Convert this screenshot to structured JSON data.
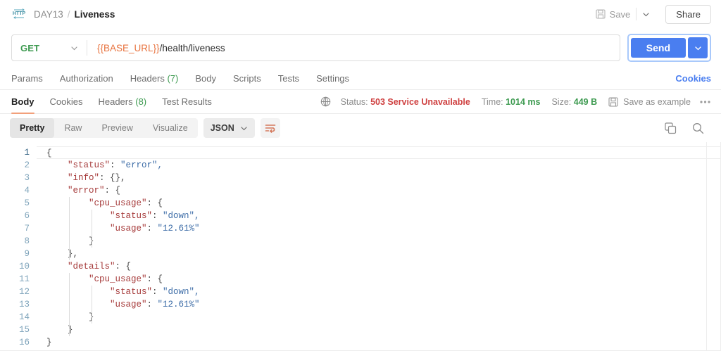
{
  "header": {
    "protocol_icon": "http-icon",
    "breadcrumb": {
      "folder": "DAY13",
      "separator": "/",
      "current": "Liveness"
    },
    "save_label": "Save",
    "share_label": "Share"
  },
  "request": {
    "method": "GET",
    "url_variable": "{{BASE_URL}}",
    "url_path": "/health/liveness",
    "send_label": "Send",
    "tabs": [
      {
        "label": "Params",
        "count": null,
        "active": false
      },
      {
        "label": "Authorization",
        "count": null,
        "active": false
      },
      {
        "label": "Headers",
        "count": "(7)",
        "active": false
      },
      {
        "label": "Body",
        "count": null,
        "active": false
      },
      {
        "label": "Scripts",
        "count": null,
        "active": false
      },
      {
        "label": "Tests",
        "count": null,
        "active": false
      },
      {
        "label": "Settings",
        "count": null,
        "active": false
      }
    ],
    "cookies_link": "Cookies"
  },
  "response": {
    "tabs": [
      {
        "label": "Body",
        "count": null,
        "active": true
      },
      {
        "label": "Cookies",
        "count": null,
        "active": false
      },
      {
        "label": "Headers",
        "count": "(8)",
        "active": false
      },
      {
        "label": "Test Results",
        "count": null,
        "active": false
      }
    ],
    "status": {
      "status_label": "Status:",
      "status_value": "503 Service Unavailable",
      "time_label": "Time:",
      "time_value": "1014 ms",
      "size_label": "Size:",
      "size_value": "449 B"
    },
    "save_as_example": "Save as example",
    "more_menu": "•••",
    "format_tabs": [
      {
        "label": "Pretty",
        "active": true
      },
      {
        "label": "Raw",
        "active": false
      },
      {
        "label": "Preview",
        "active": false
      },
      {
        "label": "Visualize",
        "active": false
      }
    ],
    "content_type": "JSON"
  },
  "code": {
    "lines": [
      {
        "n": "1",
        "indent": 0,
        "text": "{"
      },
      {
        "n": "2",
        "indent": 1,
        "text": "\"status\": \"error\","
      },
      {
        "n": "3",
        "indent": 1,
        "text": "\"info\": {},"
      },
      {
        "n": "4",
        "indent": 1,
        "text": "\"error\": {"
      },
      {
        "n": "5",
        "indent": 2,
        "text": "\"cpu_usage\": {"
      },
      {
        "n": "6",
        "indent": 3,
        "text": "\"status\": \"down\","
      },
      {
        "n": "7",
        "indent": 3,
        "text": "\"usage\": \"12.61%\""
      },
      {
        "n": "8",
        "indent": 2,
        "text": "}"
      },
      {
        "n": "9",
        "indent": 1,
        "text": "},"
      },
      {
        "n": "10",
        "indent": 1,
        "text": "\"details\": {"
      },
      {
        "n": "11",
        "indent": 2,
        "text": "\"cpu_usage\": {"
      },
      {
        "n": "12",
        "indent": 3,
        "text": "\"status\": \"down\","
      },
      {
        "n": "13",
        "indent": 3,
        "text": "\"usage\": \"12.61%\""
      },
      {
        "n": "14",
        "indent": 2,
        "text": "}"
      },
      {
        "n": "15",
        "indent": 1,
        "text": "}"
      },
      {
        "n": "16",
        "indent": 0,
        "text": "}"
      }
    ],
    "json": {
      "status": "error",
      "info": {},
      "error": {
        "cpu_usage": {
          "status": "down",
          "usage": "12.61%"
        }
      },
      "details": {
        "cpu_usage": {
          "status": "down",
          "usage": "12.61%"
        }
      }
    }
  },
  "colors": {
    "accent_blue": "#4a7ef0",
    "method_green": "#3d9a50",
    "error_red": "#cf4141",
    "variable_orange": "#e8733f",
    "active_tab_underline": "#f2a07b",
    "json_key": "#a63b3b",
    "json_string": "#3f6ea8",
    "gutter_number": "#7fa4bb"
  }
}
